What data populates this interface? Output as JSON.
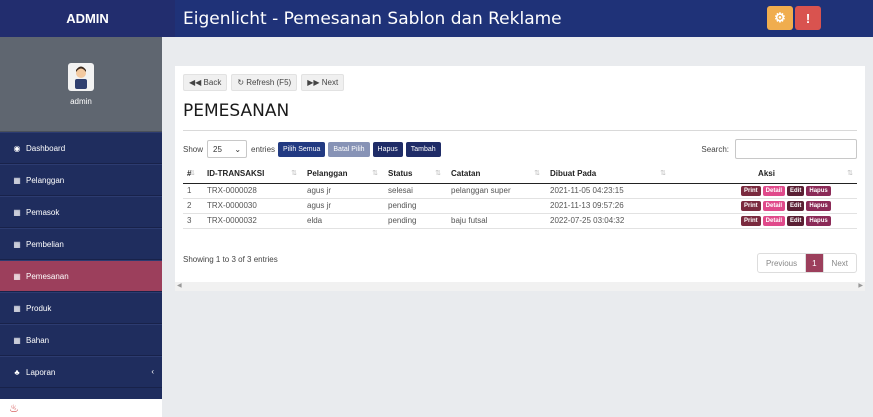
{
  "header": {
    "brand": "ADMIN",
    "title": "Eigenlicht - Pemesanan Sablon dan Reklame",
    "alert_glyph": "!"
  },
  "sidebar": {
    "user": "admin",
    "items": [
      {
        "label": "Dashboard",
        "icon": "dashboard-icon"
      },
      {
        "label": "Pelanggan",
        "icon": "table-icon"
      },
      {
        "label": "Pemasok",
        "icon": "table-icon"
      },
      {
        "label": "Pembelian",
        "icon": "table-icon"
      },
      {
        "label": "Pemesanan",
        "icon": "table-icon",
        "active": true
      },
      {
        "label": "Produk",
        "icon": "table-icon"
      },
      {
        "label": "Bahan",
        "icon": "table-icon"
      },
      {
        "label": "Laporan",
        "icon": "report-icon"
      }
    ]
  },
  "nav": {
    "back": "Back",
    "refresh": "Refresh (F5)",
    "next": "Next"
  },
  "page": {
    "title": "PEMESANAN"
  },
  "controls": {
    "show": "Show",
    "entries_value": "25",
    "entries": "entries",
    "pilih_semua": "Pilih Semua",
    "batal_pilih": "Batal Pilih",
    "hapus": "Hapus",
    "tambah": "Tambah",
    "search_label": "Search:"
  },
  "table": {
    "headers": [
      "#",
      "ID-TRANSAKSI",
      "Pelanggan",
      "Status",
      "Catatan",
      "Dibuat Pada",
      "Aksi"
    ],
    "rows": [
      [
        "1",
        "TRX-0000028",
        "agus jr",
        "selesai",
        "pelanggan super",
        "2021-11-05 04:23:15"
      ],
      [
        "2",
        "TRX-0000030",
        "agus jr",
        "pending",
        "",
        "2021-11-13 09:57:26"
      ],
      [
        "3",
        "TRX-0000032",
        "elda",
        "pending",
        "baju futsal",
        "2022-07-25 03:04:32"
      ]
    ],
    "actions": [
      "Print",
      "Detail",
      "Edit",
      "Hapus"
    ]
  },
  "footer": {
    "info": "Showing 1 to 3 of 3 entries",
    "previous": "Previous",
    "page": "1",
    "next": "Next"
  },
  "colors": {
    "sidebar": "#1f2d5e",
    "topbar": "#1f3278",
    "active": "#9c3f5c",
    "gear": "#f0ad4e",
    "alert": "#d9534f"
  }
}
